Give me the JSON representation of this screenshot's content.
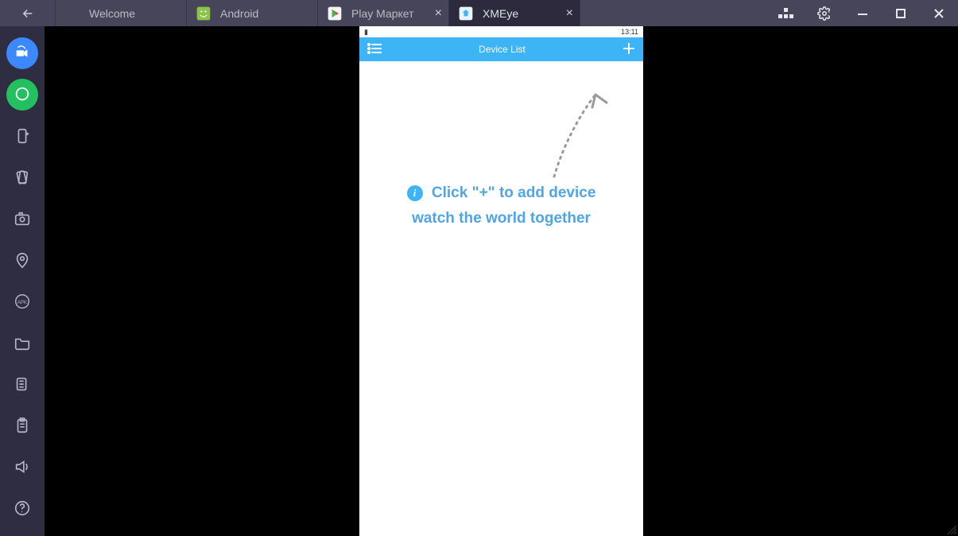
{
  "titlebar": {
    "tabs": [
      {
        "label": "Welcome",
        "icon": "none",
        "closeable": false,
        "active": false
      },
      {
        "label": "Android",
        "icon": "android",
        "closeable": false,
        "active": false
      },
      {
        "label": "Play Маркет",
        "icon": "play-store",
        "closeable": true,
        "active": false
      },
      {
        "label": "XMEye",
        "icon": "xmeye",
        "closeable": true,
        "active": true
      }
    ]
  },
  "sidebar": {
    "items": [
      "camera-icon",
      "chat-icon",
      "rotate-icon",
      "shake-icon",
      "screenshot-icon",
      "location-icon",
      "apk-icon",
      "folder-icon",
      "copy-icon",
      "clipboard-icon",
      "volume-icon",
      "help-icon"
    ]
  },
  "phone": {
    "status_time": "13:11",
    "appbar_title": "Device List",
    "hint_line1": "Click \"+\" to add device",
    "hint_line2": "watch the world together"
  }
}
